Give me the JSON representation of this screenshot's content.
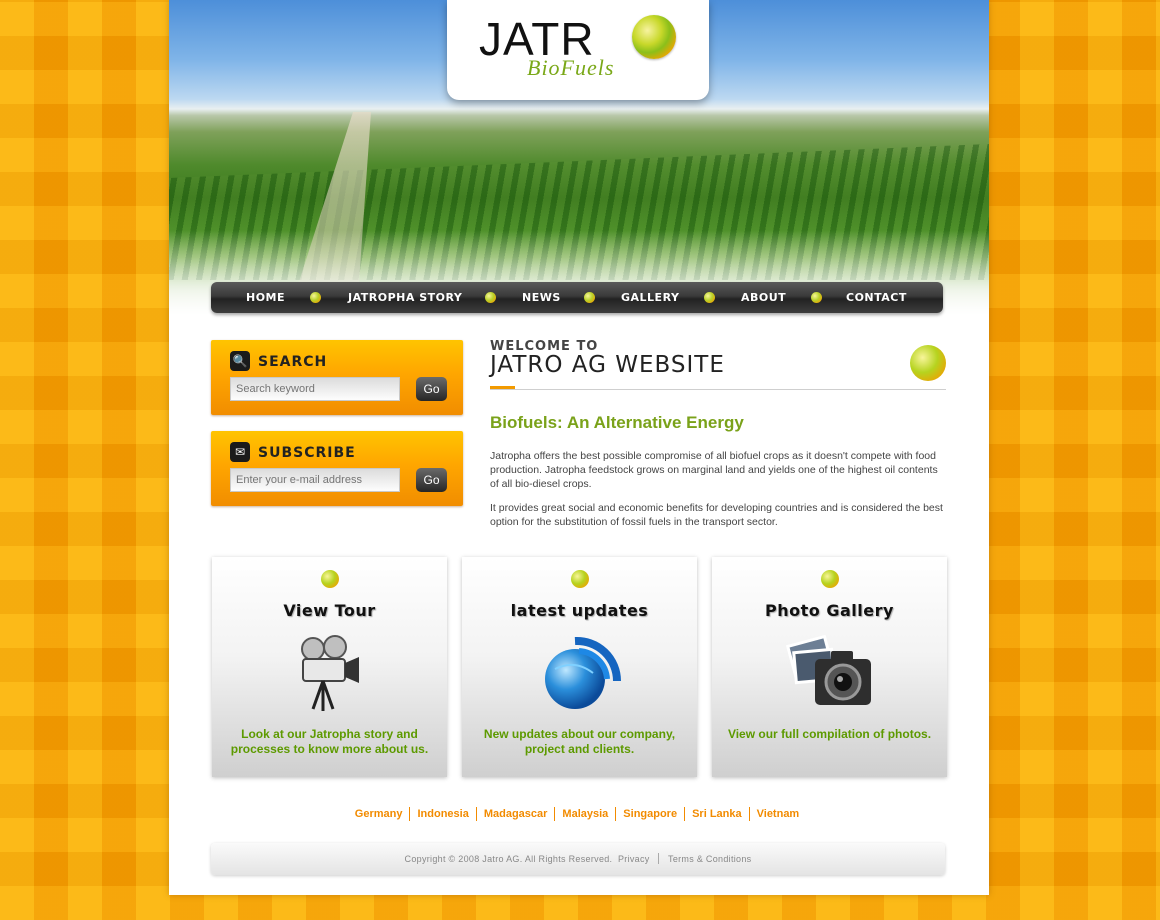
{
  "logo": {
    "main": "JATR",
    "sub": "BioFuels"
  },
  "nav": [
    "Home",
    "Jatropha Story",
    "News",
    "Gallery",
    "About",
    "Contact"
  ],
  "search": {
    "title": "Search",
    "placeholder": "Search keyword",
    "button": "Go"
  },
  "subscribe": {
    "title": "Subscribe",
    "placeholder": "Enter your e-mail address",
    "button": "Go"
  },
  "welcome": {
    "small": "Welcome to",
    "big": "Jatro AG Website"
  },
  "headline": "Biofuels: An Alternative Energy",
  "paragraphs": [
    "Jatropha offers the best possible compromise of all biofuel crops as it doesn't compete with food production. Jatropha feedstock grows on marginal land and yields one of the highest oil contents of all bio-diesel crops.",
    "It provides great social and economic benefits for developing countries and is considered the best option for the substitution of fossil fuels in the transport sector."
  ],
  "features": [
    {
      "title": "View Tour",
      "text": "Look at our Jatropha story and processes to know more about us.",
      "icon": "movie-camera-icon"
    },
    {
      "title": "latest updates",
      "text": "New updates about our company, project and clients.",
      "icon": "globe-rss-icon"
    },
    {
      "title": "Photo Gallery",
      "text": "View our full compilation of photos.",
      "icon": "camera-photos-icon"
    }
  ],
  "countries": [
    "Germany",
    "Indonesia",
    "Madagascar",
    "Malaysia",
    "Singapore",
    "Sri Lanka",
    "Vietnam"
  ],
  "footer": {
    "copyright": "Copyright © 2008 Jatro AG. All Rights Reserved.",
    "privacy": "Privacy",
    "terms": "Terms & Conditions"
  }
}
